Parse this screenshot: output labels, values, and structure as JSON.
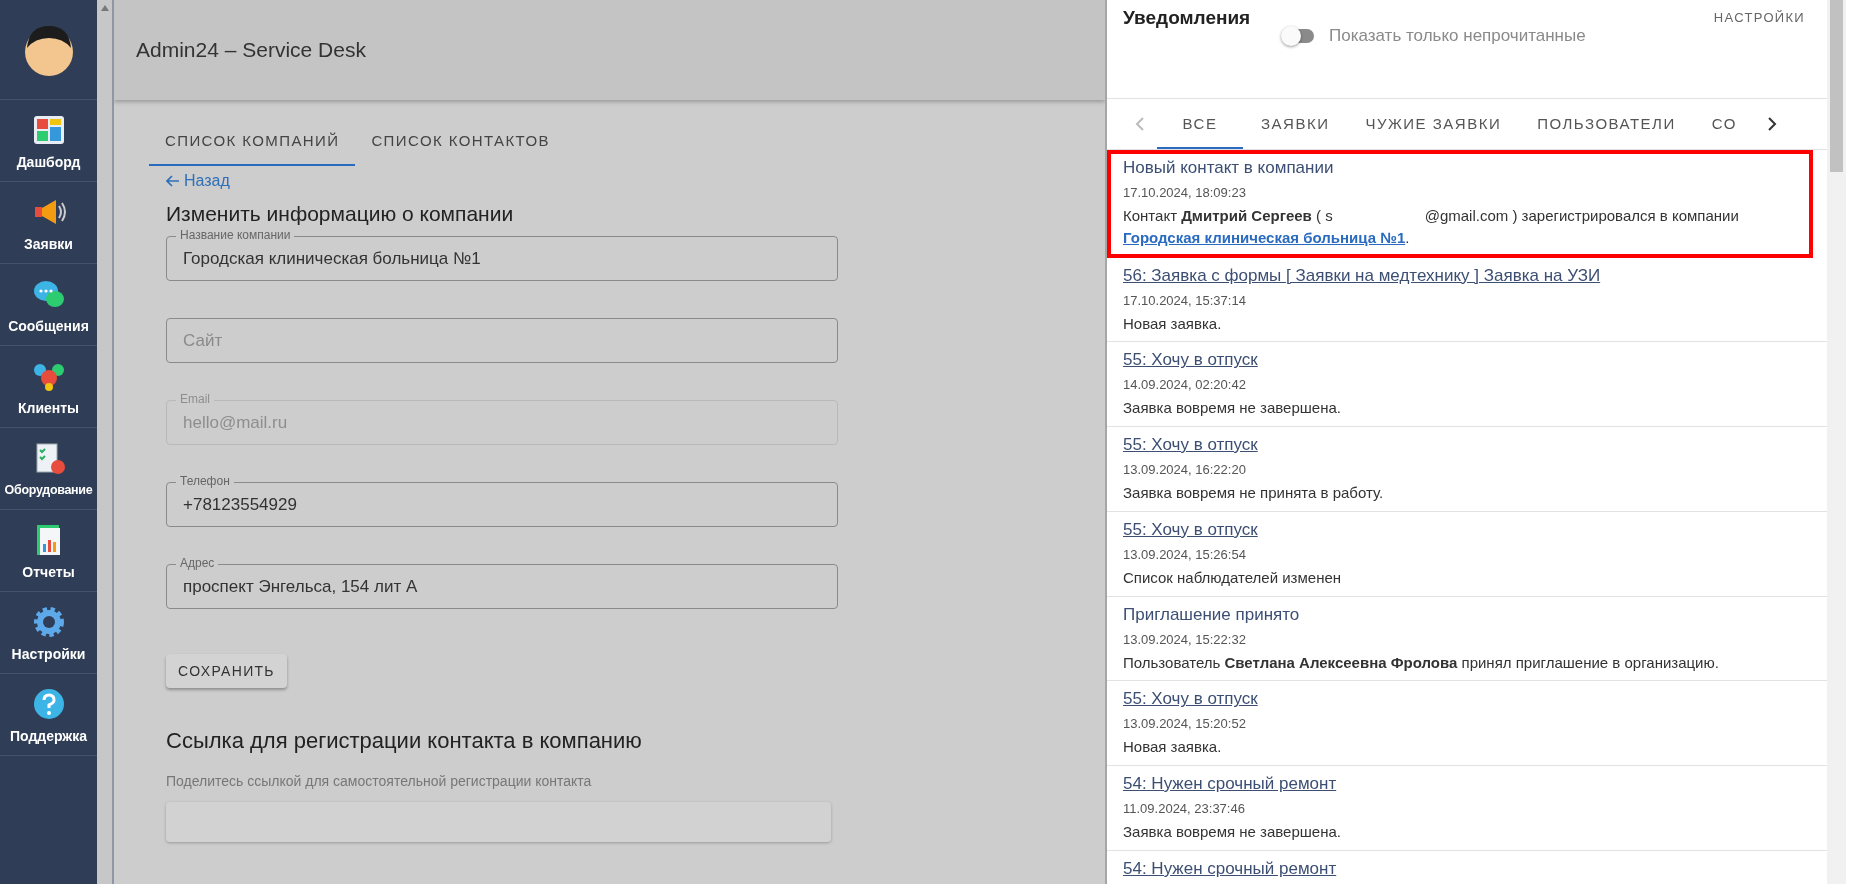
{
  "sidebar": {
    "items": [
      {
        "label": "Дашборд",
        "kind": "dashboard",
        "selected": false
      },
      {
        "label": "Заявки",
        "kind": "megaphone",
        "selected": false
      },
      {
        "label": "Сообщения",
        "kind": "chat",
        "selected": false
      },
      {
        "label": "Клиенты",
        "kind": "people",
        "selected": false
      },
      {
        "label": "Оборудование",
        "kind": "checklist",
        "selected": false
      },
      {
        "label": "Отчеты",
        "kind": "report",
        "selected": false
      },
      {
        "label": "Настройки",
        "kind": "gear",
        "selected": false
      },
      {
        "label": "Поддержка",
        "kind": "help",
        "selected": false
      }
    ]
  },
  "header": {
    "title": "Admin24 – Service Desk"
  },
  "page_tabs": [
    {
      "label": "СПИСОК КОМПАНИЙ",
      "selected": true
    },
    {
      "label": "СПИСОК КОНТАКТОВ",
      "selected": false
    }
  ],
  "back_link": "Назад",
  "form": {
    "title": "Изменить информацию о компании",
    "fields": [
      {
        "label": "Название компании",
        "value": "Городская клиническая больница №1",
        "disabled": false
      },
      {
        "placeholder": "Сайт",
        "disabled": false
      },
      {
        "label": "Email",
        "value": "hello@mail.ru",
        "disabled": true
      },
      {
        "label": "Телефон",
        "value": "+78123554929",
        "disabled": false
      },
      {
        "label": "Адрес",
        "value": "проспект Энгельса, 154 лит А",
        "disabled": false
      }
    ],
    "save_button": "СОХРАНИТЬ"
  },
  "registration": {
    "title": "Ссылка для регистрации контакта в компанию",
    "hint": "Поделитесь ссылкой для самостоятельной регистрации контакта"
  },
  "notifications": {
    "title": "Уведомления",
    "unread_only": {
      "label": "Показать только непрочитанные",
      "on": false
    },
    "settings": "НАСТРОЙКИ",
    "tabs": [
      {
        "label": "ВСЕ",
        "selected": true
      },
      {
        "label": "ЗАЯВКИ",
        "selected": false
      },
      {
        "label": "ЧУЖИЕ ЗАЯВКИ",
        "selected": false
      },
      {
        "label": "ПОЛЬЗОВАТЕЛИ",
        "selected": false
      },
      {
        "label": "СО",
        "selected": false
      }
    ],
    "items": [
      {
        "title": "Новый контакт в компании",
        "title_link": false,
        "date": "17.10.2024, 18:09:23",
        "body": "Контакт **Дмитрий Сергеев** ( s",
        "body_rest": "@gmail.com ) зарегистрировался в компании",
        "link": "Городская клиническая больница №1",
        "link_tail": ".",
        "highlighted": true
      },
      {
        "title": "56: Заявка с формы [ Заявки на медтехнику ] Заявка на УЗИ",
        "title_link": true,
        "date": "17.10.2024, 15:37:14",
        "body": "Новая заявка.",
        "highlighted": false
      },
      {
        "title": "55: Хочу в отпуск",
        "title_link": true,
        "date": "14.09.2024, 02:20:42",
        "body": "Заявка вовремя не завершена.",
        "highlighted": false
      },
      {
        "title": "55: Хочу в отпуск",
        "title_link": true,
        "date": "13.09.2024, 16:22:20",
        "body": "Заявка вовремя не принята в работу.",
        "highlighted": false
      },
      {
        "title": "55: Хочу в отпуск",
        "title_link": true,
        "date": "13.09.2024, 15:26:54",
        "body": "Список наблюдателей изменен",
        "highlighted": false
      },
      {
        "title": "Приглашение принято",
        "title_link": false,
        "date": "13.09.2024, 15:22:32",
        "body": "Пользователь **Светлана Алексеевна Фролова** принял приглашение в организацию.",
        "highlighted": false
      },
      {
        "title": "55: Хочу в отпуск",
        "title_link": true,
        "date": "13.09.2024, 15:20:52",
        "body": "Новая заявка.",
        "highlighted": false
      },
      {
        "title": "54: Нужен срочный ремонт",
        "title_link": true,
        "date": "11.09.2024, 23:37:46",
        "body": "Заявка вовремя не завершена.",
        "highlighted": false
      },
      {
        "title": "54: Нужен срочный ремонт",
        "title_link": true,
        "highlighted": false
      }
    ]
  }
}
